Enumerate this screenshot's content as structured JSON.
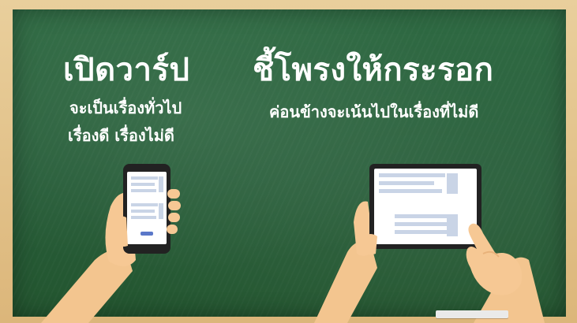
{
  "left": {
    "title": "เปิดวาร์ป",
    "subtitle_line1": "จะเป็นเรื่องทั่วไป",
    "subtitle_line2": "เรื่องดี เรื่องไม่ดี"
  },
  "right": {
    "title": "ชี้โพรงให้กระรอก",
    "subtitle": "ค่อนข้างจะเน้นไปในเรื่องที่ไม่ดี"
  },
  "colors": {
    "board": "#2b623d",
    "frame": "#e2c48b",
    "skin": "#f6c894",
    "sleeve": "#f3c58f",
    "device_frame": "#222222",
    "screen": "#ffffff",
    "screen_lines": "#c9d4e6",
    "screen_button": "#5b78c9"
  },
  "icons": {
    "left_device": "smartphone-icon",
    "right_device": "tablet-icon"
  }
}
